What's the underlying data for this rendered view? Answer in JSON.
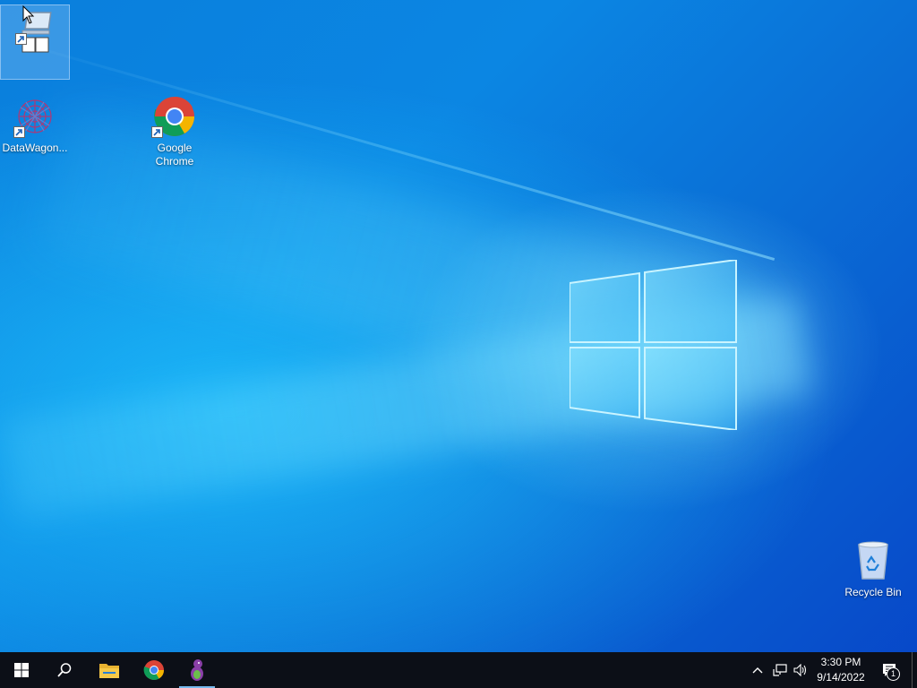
{
  "desktop": {
    "icons": [
      {
        "label": "",
        "icon": "network-shortcut-icon"
      },
      {
        "label": "DataWagon...",
        "icon": "datawagon-icon"
      },
      {
        "label": "Google Chrome",
        "icon": "chrome-icon"
      },
      {
        "label": "Recycle Bin",
        "icon": "recycle-bin-icon"
      }
    ]
  },
  "taskbar": {
    "start": "start-icon",
    "search": "search-icon",
    "pinned": [
      "file-explorer-icon",
      "chrome-icon",
      "barney-app-icon"
    ],
    "tray": {
      "clock_time": "3:30 PM",
      "clock_date": "9/14/2022",
      "notification_count": "1"
    }
  },
  "colors": {
    "taskbar": "#0c0f17",
    "desktop_blue": "#0a7fdc",
    "active_indicator": "#76b9ed"
  }
}
